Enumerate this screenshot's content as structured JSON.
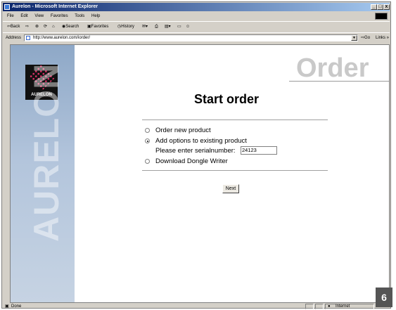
{
  "window": {
    "title": "Aurelon - Microsoft Internet Explorer",
    "controls": [
      "_",
      "□",
      "x"
    ]
  },
  "menu": [
    "File",
    "Edit",
    "View",
    "Favorites",
    "Tools",
    "Help"
  ],
  "toolbar": {
    "back": "⇦Back",
    "forward": "⇨",
    "search": "Search",
    "favorites": "Favorites",
    "history": "History"
  },
  "address": {
    "label": "Address",
    "url": "http://www.aurelon.com/iorder/",
    "go": "Go",
    "links": "Links »"
  },
  "sidebar": {
    "logo_text": "AURELON",
    "vertical_text": "AURELON"
  },
  "page": {
    "banner": "Order",
    "title": "Start order",
    "options": [
      {
        "label": "Order new product",
        "selected": false
      },
      {
        "label": "Add options to existing product",
        "selected": true
      },
      {
        "label": "Download Dongle Writer",
        "selected": false
      }
    ],
    "serial_label": "Please enter serialnumber:",
    "serial_value": "24123",
    "next": "Next"
  },
  "status": {
    "text": "Done",
    "zone": "Internet"
  },
  "badge": "6"
}
